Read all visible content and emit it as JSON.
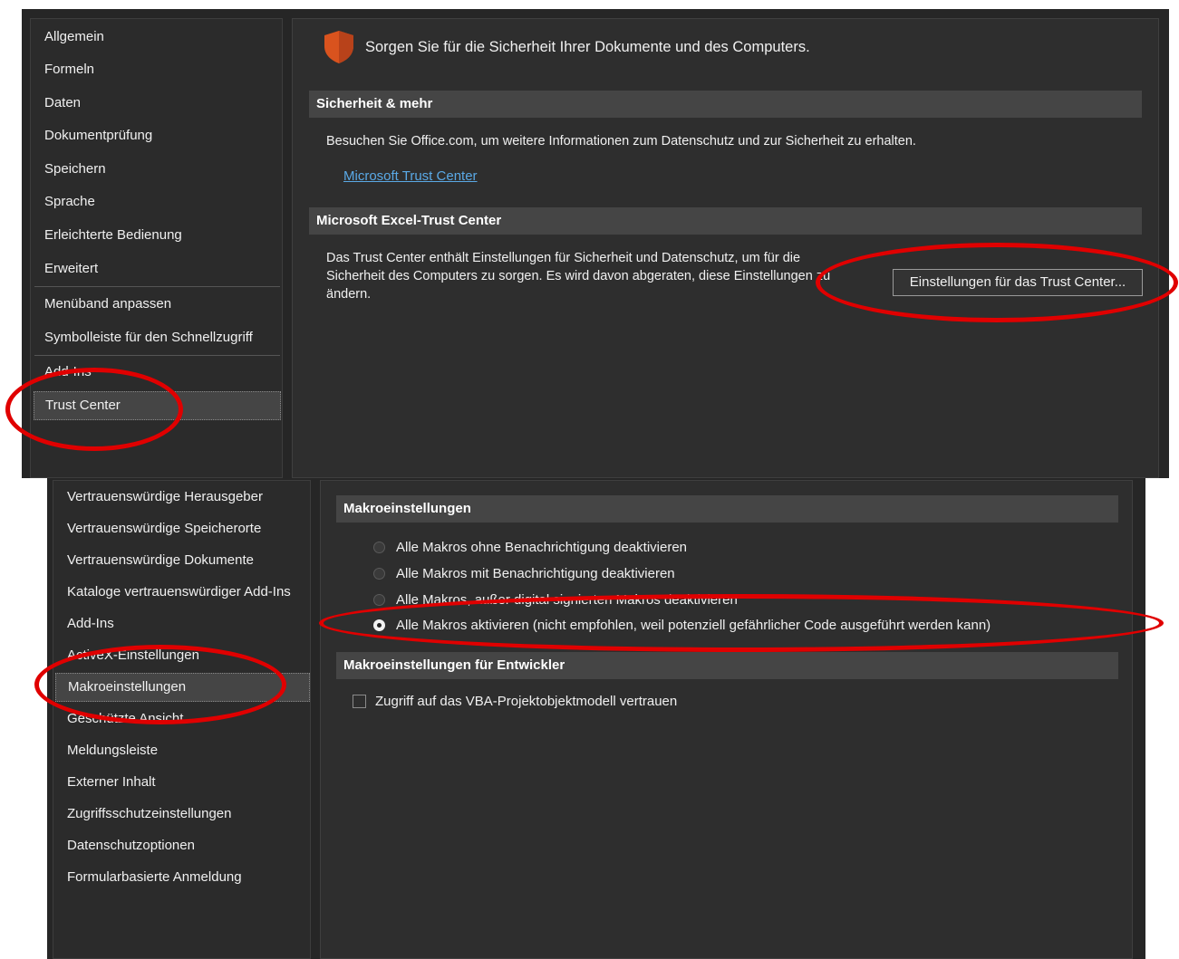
{
  "top": {
    "sidebar": {
      "items": [
        {
          "label": "Allgemein"
        },
        {
          "label": "Formeln"
        },
        {
          "label": "Daten"
        },
        {
          "label": "Dokumentprüfung"
        },
        {
          "label": "Speichern"
        },
        {
          "label": "Sprache"
        },
        {
          "label": "Erleichterte Bedienung"
        },
        {
          "label": "Erweitert"
        },
        {
          "label": "Menüband anpassen"
        },
        {
          "label": "Symbolleiste für den Schnellzugriff"
        },
        {
          "label": "Add-Ins"
        },
        {
          "label": "Trust Center"
        }
      ],
      "selected": "Trust Center"
    },
    "header_text": "Sorgen Sie für die Sicherheit Ihrer Dokumente und des Computers.",
    "section1": {
      "title": "Sicherheit & mehr",
      "text": "Besuchen Sie Office.com, um weitere Informationen zum Datenschutz und zur Sicherheit zu erhalten.",
      "link": "Microsoft Trust Center"
    },
    "section2": {
      "title": "Microsoft Excel-Trust Center",
      "line1": "Das Trust Center enthält Einstellungen für Sicherheit und Datenschutz, um für die",
      "line2": "Sicherheit des Computers zu sorgen. Es wird davon abgeraten, diese Einstellungen zu",
      "line3": "ändern.",
      "button": "Einstellungen für das Trust Center..."
    }
  },
  "bottom": {
    "sidebar": {
      "items": [
        {
          "label": "Vertrauenswürdige Herausgeber"
        },
        {
          "label": "Vertrauenswürdige Speicherorte"
        },
        {
          "label": "Vertrauenswürdige Dokumente"
        },
        {
          "label": "Kataloge vertrauenswürdiger Add-Ins"
        },
        {
          "label": "Add-Ins"
        },
        {
          "label": "ActiveX-Einstellungen"
        },
        {
          "label": "Makroeinstellungen"
        },
        {
          "label": "Geschützte Ansicht"
        },
        {
          "label": "Meldungsleiste"
        },
        {
          "label": "Externer Inhalt"
        },
        {
          "label": "Zugriffsschutzeinstellungen"
        },
        {
          "label": "Datenschutzoptionen"
        },
        {
          "label": "Formularbasierte Anmeldung"
        }
      ],
      "selected": "Makroeinstellungen"
    },
    "macro_section": {
      "title": "Makroeinstellungen",
      "options": [
        {
          "label": "Alle Makros ohne Benachrichtigung deaktivieren",
          "checked": false
        },
        {
          "label": "Alle Makros mit Benachrichtigung deaktivieren",
          "checked": false
        },
        {
          "label": "Alle Makros, außer digital signierten Makros deaktivieren",
          "checked": false
        },
        {
          "label": "Alle Makros aktivieren (nicht empfohlen, weil potenziell gefährlicher Code ausgeführt werden kann)",
          "checked": true
        }
      ]
    },
    "dev_section": {
      "title": "Makroeinstellungen für Entwickler",
      "checkbox_label": "Zugriff auf das VBA-Projektobjektmodell vertrauen",
      "checked": false
    }
  },
  "colors": {
    "annotation": "#e00000",
    "link": "#5aa9e6",
    "shield": "#d9531e"
  }
}
